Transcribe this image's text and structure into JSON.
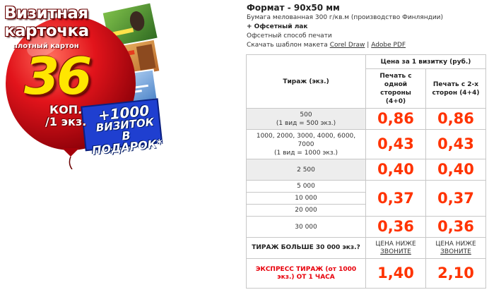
{
  "promo": {
    "title_line1": "Визитная",
    "title_line2": "карточка",
    "subtitle": "плотный картон",
    "price": "36",
    "unit_line1": "КОП.",
    "unit_line2": "/1 экз.",
    "gift_line1": "+1000",
    "gift_line2": "ВИЗИТОК",
    "gift_line3": "В ПОДАРОК*",
    "colors": {
      "balloon": "#e2141b",
      "price_text": "#ffe600",
      "gift_banner": "#1f3fd0"
    }
  },
  "info": {
    "format": "Формат - 90х50 мм",
    "paper": "Бумага мелованная 300 г/кв.м (производство Финляндии)",
    "lacquer": "+ Офсетный лак",
    "method": "Офсетный способ печати",
    "template_prefix": "Скачать шаблон макета",
    "link_coreldraw": "Corel Draw",
    "separator": "|",
    "link_pdf": "Adobe PDF"
  },
  "table": {
    "header_qty": "Тираж (экз.)",
    "header_price": "Цена за 1 визитку (руб.)",
    "header_one_side": "Печать с одной стороны (4+0)",
    "header_two_sides": "Печать с 2-х сторон (4+4)",
    "rows": [
      {
        "qty": "500",
        "note": "(1 вид = 500 экз.)",
        "one": "0,86",
        "two": "0,86"
      },
      {
        "qty": "1000, 2000, 3000, 4000, 6000, 7000",
        "note": "(1 вид = 1000 экз.)",
        "one": "0,43",
        "two": "0,43"
      },
      {
        "qty": "2 500",
        "note": "",
        "one": "0,40",
        "two": "0,40"
      },
      {
        "qty_group": [
          "5 000",
          "10 000",
          "20 000"
        ],
        "one": "0,37",
        "two": "0,37"
      },
      {
        "qty": "30 000",
        "note": "",
        "one": "0,36",
        "two": "0,36"
      }
    ],
    "big_run_label": "ТИРАЖ БОЛЬШЕ 30 000 экз.?",
    "lower_price": "ЦЕНА НИЖЕ",
    "call_link": "ЗВОНИТЕ",
    "express_label": "ЭКСПРЕСС ТИРАЖ (от 1000 экз.) ОТ 1 ЧАСА",
    "express_one": "1,40",
    "express_two": "2,10",
    "colors": {
      "price": "#ff3300",
      "express": "#e8000b",
      "border": "#c7c7c7"
    }
  }
}
